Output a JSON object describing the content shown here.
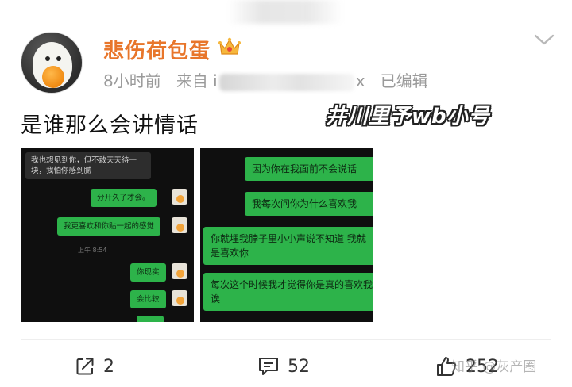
{
  "post": {
    "username": "悲伤荷包蛋",
    "meta_time": "8小时前",
    "meta_from_prefix": "来自 i",
    "meta_from_suffix": "x",
    "meta_edited": "已编辑",
    "text": "是谁那么会讲情话",
    "overlay_watermark": "井川里予wb小号"
  },
  "image1": {
    "left_message": "我也想见到你，但不敢天天待一块，我怕你感到腻",
    "msgs": [
      "分开久了才会。",
      "我更喜欢和你贴一起的感觉",
      "你现实",
      "会比较"
    ],
    "time": "上午 8:54"
  },
  "image2": {
    "msgs": [
      "因为你在我面前不会说话",
      "我每次问你为什么喜欢我",
      "你就埋我脖子里小小声说不知道 我就是喜欢你",
      "每次这个时候我才觉得你是真的喜欢我诶"
    ]
  },
  "actions": {
    "share_count": "2",
    "comment_count": "52",
    "like_count": "252"
  },
  "watermark_bottom": "知乎 @灰产圈",
  "icons": {
    "crown": "crown-icon",
    "chevron": "chevron-down-icon",
    "share": "share-icon",
    "comment": "comment-icon",
    "like": "thumbs-up-icon"
  },
  "colors": {
    "username": "#e8762b",
    "chat_green": "#2db34a",
    "chat_bg": "#0f0f0f"
  }
}
